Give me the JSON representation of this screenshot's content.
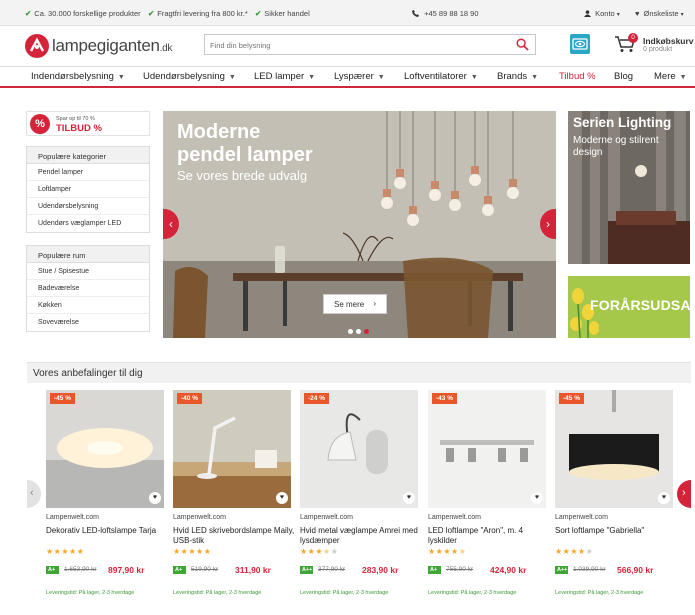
{
  "topbar": {
    "usps": [
      "Ca. 30.000 forskellige produkter",
      "Fragtfri levering fra 800 kr.*",
      "Sikker handel"
    ],
    "phone": "+45 89 88 18 90",
    "account": "Konto",
    "wishlist": "Ønskeliste"
  },
  "header": {
    "logo_main": "lampegiganten",
    "logo_tld": ".dk",
    "search_placeholder": "Find din belysning",
    "cart_title": "Indkøbskurv",
    "cart_sub": "0 produkt",
    "cart_count": "0"
  },
  "nav": {
    "items": [
      "Indendørsbelysning",
      "Udendørsbelysning",
      "LED lamper",
      "Lyspærer",
      "Loftventilatorer",
      "Brands",
      "Tilbud %",
      "Blog",
      "Mere"
    ]
  },
  "sidebar": {
    "tilbud_small": "Spar op til 70 %",
    "tilbud_big": "TILBUD %",
    "tilbud_icon": "%",
    "categories_title": "Populære kategorier",
    "categories": [
      "Pendel lamper",
      "Loftlamper",
      "Udendørsbelysning",
      "Udendørs væglamper LED"
    ],
    "rooms_title": "Populære rum",
    "rooms": [
      "Stue / Spisestue",
      "Badeværelse",
      "Køkken",
      "Soveværelse"
    ]
  },
  "hero": {
    "title_line1": "Moderne",
    "title_line2": "pendel lamper",
    "subtitle": "Se vores brede udvalg",
    "button": "Se mere",
    "active_slide": 3,
    "slide_count": 3
  },
  "serien": {
    "title": "Serien Lighting",
    "text": "Moderne og stilrent design"
  },
  "forar": {
    "text": "FORÅRSUDSALG"
  },
  "recommendations": {
    "title": "Vores anbefalinger til dig",
    "products": [
      {
        "discount": "-45 %",
        "shop": "Lampenwelt.com",
        "name": "Dekorativ LED-loftslampe Tarja",
        "stars": 5,
        "energy": "A+",
        "old_price": "1.653,90 kr",
        "price": "897,90 kr",
        "delivery": "Leveringstid: På lager, 2-3 hverdage"
      },
      {
        "discount": "-40 %",
        "shop": "Lampenwelt.com",
        "name": "Hvid LED skrivebordslampe Maily, USB-stik",
        "stars": 5,
        "energy": "A+",
        "old_price": "519,90 kr",
        "price": "311,90 kr",
        "delivery": "Leveringstid: På lager, 2-3 hverdage"
      },
      {
        "discount": "-24 %",
        "shop": "Lampenwelt.com",
        "name": "Hvid metal væglampe Amrei med lysdæmper",
        "stars": 3.5,
        "energy": "A++",
        "old_price": "377,90 kr",
        "price": "283,90 kr",
        "delivery": "Leveringstid: På lager, 2-3 hverdage"
      },
      {
        "discount": "-43 %",
        "shop": "Lampenwelt.com",
        "name": "LED loftlampe \"Aron\", m. 4 lyskilder",
        "stars": 4.5,
        "energy": "A+",
        "old_price": "755,90 kr",
        "price": "424,90 kr",
        "delivery": "Leveringstid: På lager, 2-3 hverdage"
      },
      {
        "discount": "-45 %",
        "shop": "Lampenwelt.com",
        "name": "Sort loftlampe \"Gabriella\"",
        "stars": 4,
        "energy": "A++",
        "old_price": "1.039,90 kr",
        "price": "566,90 kr",
        "delivery": "Leveringstid: På lager, 2-3 hverdage"
      }
    ]
  },
  "colors": {
    "brand_red": "#d3243a",
    "star": "#f5a623",
    "energy_green": "#3fa535",
    "discount_orange": "#e8562a"
  }
}
